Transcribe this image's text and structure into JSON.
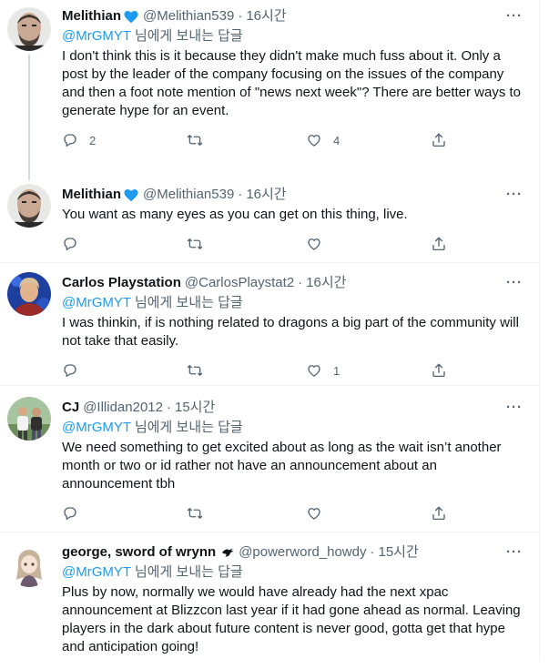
{
  "tweets": [
    {
      "name": "Melithian",
      "handle": "@Melithian539",
      "time": "16시간",
      "reply_mention": "@MrGMYT",
      "reply_suffix": " 님에게 보내는 답글",
      "text": "I don't think this is it because they didn't make much fuss about it. Only a post by the leader of the company focusing on the issues of the company and then a foot note mention of \"news next week\"? There are better ways to generate hype for an event.",
      "reply_count": "2",
      "retweet_count": "",
      "like_count": "4"
    },
    {
      "name": "Melithian",
      "handle": "@Melithian539",
      "time": "16시간",
      "text": "You want as many eyes as you can get on this thing, live.",
      "reply_count": "",
      "retweet_count": "",
      "like_count": ""
    },
    {
      "name": "Carlos Playstation",
      "handle": "@CarlosPlaystat2",
      "time": "16시간",
      "reply_mention": "@MrGMYT",
      "reply_suffix": " 님에게 보내는 답글",
      "text": "I was thinkin, if is nothing related to dragons a big part of the community will not take that easily.",
      "reply_count": "",
      "retweet_count": "",
      "like_count": "1"
    },
    {
      "name": "CJ",
      "handle": "@Illidan2012",
      "time": "15시간",
      "reply_mention": "@MrGMYT",
      "reply_suffix": " 님에게 보내는 답글",
      "text": "We need something to get excited about as long as the wait isn’t another month or two or id rather not have an announcement about an announcement tbh",
      "reply_count": "",
      "retweet_count": "",
      "like_count": ""
    },
    {
      "name": "george, sword of wrynn",
      "handle": "@powerword_howdy",
      "time": "15시간",
      "reply_mention": "@MrGMYT",
      "reply_suffix": " 님에게 보내는 답글",
      "text": "Plus by now, normally we would have already had the next xpac announcement at Blizzcon last year if it had gone ahead as normal. Leaving players in the dark about future content is never good, gotta get that hype and anticipation going!"
    }
  ],
  "more_label": "···",
  "dot_sep": "·",
  "colors": {
    "accent": "#1d9bf0",
    "secondary_text": "#536471",
    "primary_text": "#0f1419",
    "divider": "#eff3f4",
    "thread_line": "#cfd9de"
  },
  "icons": [
    "verified-badge-icon",
    "bird-emoji-icon",
    "reply-icon",
    "retweet-icon",
    "like-icon",
    "share-icon",
    "more-icon"
  ]
}
